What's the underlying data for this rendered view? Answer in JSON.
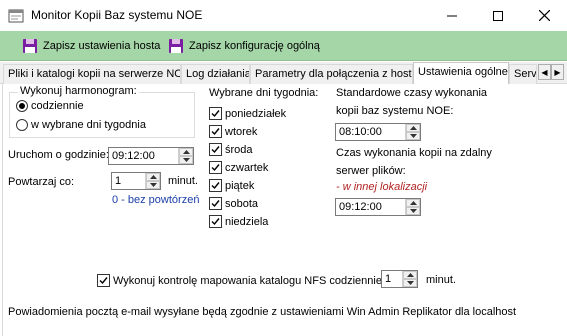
{
  "window": {
    "title": "Monitor Kopii Baz systemu NOE",
    "icon": "app-window-icon"
  },
  "toolbar": {
    "save_host_label": "Zapisz ustawienia hosta",
    "save_general_label": "Zapisz konfigurację ogólną"
  },
  "tabs": [
    {
      "label": "Pliki i katalogi kopii na serwerze NOE"
    },
    {
      "label": "Log działania"
    },
    {
      "label": "Parametry dla połączenia z hostem"
    },
    {
      "label": "Ustawienia ogólne",
      "active": true
    },
    {
      "label": "Serv"
    }
  ],
  "schedule": {
    "group_title": "Wykonuj harmonogram:",
    "option_daily": "codziennie",
    "option_days": "w wybrane dni tygodnia",
    "selected": "codziennie"
  },
  "start": {
    "label": "Uruchom o godzinie:",
    "value": "09:12:00"
  },
  "repeat": {
    "label": "Powtarzaj co:",
    "value": "1",
    "unit": "minut.",
    "hint": "0 - bez powtórzeń"
  },
  "days": {
    "title": "Wybrane dni tygodnia:",
    "items": [
      {
        "label": "poniedziałek",
        "checked": true
      },
      {
        "label": "wtorek",
        "checked": true
      },
      {
        "label": "środa",
        "checked": true
      },
      {
        "label": "czwartek",
        "checked": true
      },
      {
        "label": "piątek",
        "checked": true
      },
      {
        "label": "sobota",
        "checked": true
      },
      {
        "label": "niedziela",
        "checked": true
      }
    ]
  },
  "standard_times": {
    "title_line1": "Standardowe czasy  wykonania",
    "title_line2": "kopii baz systemu NOE:",
    "value": "08:10:00",
    "remote_line1": "Czas wykonania kopii na zdalny",
    "remote_line2": "serwer plików:",
    "remote_note": "- w innej lokalizacji",
    "remote_value": "09:12:00"
  },
  "nfs": {
    "label": "Wykonuj kontrolę mapowania katalogu NFS codziennie co",
    "checked": true,
    "value": "1",
    "unit": "minut."
  },
  "footer": {
    "note": "Powiadomienia pocztą e-mail wysyłane będą zgodnie z ustawieniami Win Admin Replikator dla localhost"
  },
  "colors": {
    "toolbar_bg": "#a5d6a7",
    "hint_text": "#1a3ea8",
    "remote_note_text": "#b22222",
    "save_icon": "#7b1fa2"
  }
}
